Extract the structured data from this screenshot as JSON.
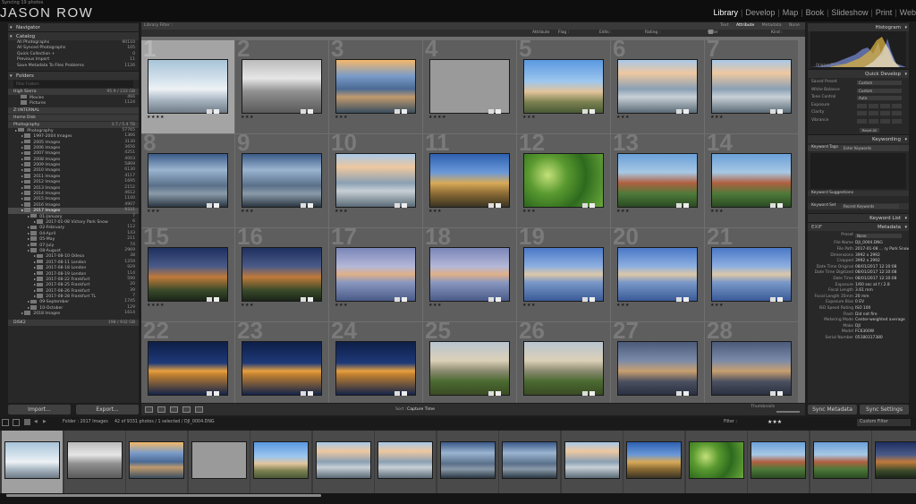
{
  "topbar": {
    "catalog_name": "Syncing 19 photos",
    "brand": "JASON ROW",
    "modules": [
      "Library",
      "Develop",
      "Map",
      "Book",
      "Slideshow",
      "Print",
      "Web"
    ],
    "active_module": "Library"
  },
  "navigator": {
    "title": "Navigator",
    "options": [
      "Fit",
      "Fill",
      "1:1",
      "3:1"
    ]
  },
  "catalog": {
    "title": "Catalog",
    "items": [
      {
        "label": "All Photographs",
        "count": "90110"
      },
      {
        "label": "All Synced Photographs",
        "count": "105"
      },
      {
        "label": "Quick Collection +",
        "count": "0"
      },
      {
        "label": "Previous Import",
        "count": "11"
      },
      {
        "label": "Save Metadata To Files Problems",
        "count": "1126"
      }
    ]
  },
  "folders": {
    "title": "Folders",
    "filter_placeholder": "Filter Folders",
    "volumes": [
      {
        "name": "High Sierra",
        "count": "95.9 / 233 GB"
      },
      {
        "name": "Z:\\INTERNAL",
        "count": ""
      },
      {
        "name": "Home Disk",
        "count": ""
      },
      {
        "name": "Photography",
        "count": "3.7 / 5.4 TB"
      }
    ],
    "high_sierra_items": [
      {
        "label": "Movies",
        "count": "466"
      },
      {
        "label": "Pictures",
        "count": "1124"
      }
    ],
    "photo_items": [
      {
        "label": "Photography",
        "count": "57765",
        "depth": 0
      },
      {
        "label": "1997-2004 Images",
        "count": "1366",
        "depth": 1
      },
      {
        "label": "2005 Images",
        "count": "3130",
        "depth": 1
      },
      {
        "label": "2006 Images",
        "count": "3656",
        "depth": 1
      },
      {
        "label": "2007 Images",
        "count": "4251",
        "depth": 1
      },
      {
        "label": "2008 Images",
        "count": "4003",
        "depth": 1
      },
      {
        "label": "2009 Images",
        "count": "5869",
        "depth": 1
      },
      {
        "label": "2010 Images",
        "count": "6130",
        "depth": 1
      },
      {
        "label": "2011 Images",
        "count": "4117",
        "depth": 1
      },
      {
        "label": "2012 Images",
        "count": "1695",
        "depth": 1
      },
      {
        "label": "2013 Images",
        "count": "2152",
        "depth": 1
      },
      {
        "label": "2014 Images",
        "count": "4612",
        "depth": 1
      },
      {
        "label": "2015 Images",
        "count": "1100",
        "depth": 1
      },
      {
        "label": "2016 Images",
        "count": "4907",
        "depth": 1
      },
      {
        "label": "2017 Images",
        "count": "9331",
        "depth": 1,
        "sel": true
      },
      {
        "label": "01-January",
        "count": "7",
        "depth": 2
      },
      {
        "label": "2017-01-08 Victory Park Snow",
        "count": "6",
        "depth": 3
      },
      {
        "label": "02-February",
        "count": "112",
        "depth": 2
      },
      {
        "label": "04-April",
        "count": "143",
        "depth": 2
      },
      {
        "label": "05-May",
        "count": "211",
        "depth": 2
      },
      {
        "label": "07-July",
        "count": "74",
        "depth": 2
      },
      {
        "label": "08-August",
        "count": "2969",
        "depth": 2
      },
      {
        "label": "2017-08-10 Odesa",
        "count": "38",
        "depth": 3
      },
      {
        "label": "2017-08-11 London",
        "count": "1259",
        "depth": 3
      },
      {
        "label": "2017-08-18 London",
        "count": "929",
        "depth": 3
      },
      {
        "label": "2017-08-19 London",
        "count": "114",
        "depth": 3
      },
      {
        "label": "2017-08-22 Frankfurt",
        "count": "590",
        "depth": 3
      },
      {
        "label": "2017-08-25 Frankfurt",
        "count": "20",
        "depth": 3
      },
      {
        "label": "2017-08-26 Frankfurt",
        "count": "39",
        "depth": 3
      },
      {
        "label": "2017-08-28 Frankfurt TL",
        "count": "7",
        "depth": 3
      },
      {
        "label": "09-September",
        "count": "1745",
        "depth": 2
      },
      {
        "label": "10-October",
        "count": "129",
        "depth": 2
      },
      {
        "label": "2018 Images",
        "count": "1614",
        "depth": 1
      }
    ],
    "bottom_volume": {
      "name": "DISK2",
      "count": "198 / 932 GB"
    }
  },
  "buttons": {
    "import": "Import...",
    "export": "Export...",
    "sync_metadata": "Sync Metadata",
    "sync_settings": "Sync Settings"
  },
  "library_filter": {
    "title": "Library Filter :",
    "tabs": [
      "Text",
      "Attribute",
      "Metadata",
      "None"
    ],
    "active": "Attribute",
    "attr_label": "Attribute",
    "flag_label": "Flag :",
    "edits_label": "Edits :",
    "rating_label": "Rating :",
    "color_label": "Color :",
    "kind_label": "Kind :",
    "color_swatches": [
      "#c83c3c",
      "#d8c040",
      "#50a040",
      "#4070c8",
      "#8050b0",
      "#888888"
    ]
  },
  "grid": {
    "cells": [
      {
        "n": "1",
        "cls": "t-snow",
        "stars": "★★★★",
        "sel": true
      },
      {
        "n": "2",
        "cls": "t-bw",
        "stars": "★★★"
      },
      {
        "n": "3",
        "cls": "t-opera",
        "stars": "★★★"
      },
      {
        "n": "4",
        "cls": "t-gray",
        "stars": "★★★★"
      },
      {
        "n": "5",
        "cls": "t-opera2",
        "stars": "★★★"
      },
      {
        "n": "6",
        "cls": "t-city",
        "stars": "★★★"
      },
      {
        "n": "7",
        "cls": "t-city",
        "stars": "★★★"
      },
      {
        "n": "8",
        "cls": "t-cityd",
        "stars": "★★★"
      },
      {
        "n": "9",
        "cls": "t-cityd",
        "stars": "★★★"
      },
      {
        "n": "10",
        "cls": "t-city",
        "stars": "★★★"
      },
      {
        "n": "11",
        "cls": "t-square",
        "stars": "★★★"
      },
      {
        "n": "12",
        "cls": "t-leaves",
        "stars": "★★★"
      },
      {
        "n": "13",
        "cls": "t-red",
        "stars": "★★★"
      },
      {
        "n": "14",
        "cls": "t-red",
        "stars": "★★★"
      },
      {
        "n": "15",
        "cls": "t-dusk",
        "stars": "★★★★"
      },
      {
        "n": "16",
        "cls": "t-dusk",
        "stars": "★★★"
      },
      {
        "n": "17",
        "cls": "t-parl",
        "stars": "★★★"
      },
      {
        "n": "18",
        "cls": "t-parl",
        "stars": "★★★"
      },
      {
        "n": "19",
        "cls": "t-parlb",
        "stars": "★★★"
      },
      {
        "n": "20",
        "cls": "t-parlb",
        "stars": "★★★"
      },
      {
        "n": "21",
        "cls": "t-parlb",
        "stars": "★★★"
      },
      {
        "n": "22",
        "cls": "t-night",
        "stars": ""
      },
      {
        "n": "23",
        "cls": "t-night",
        "stars": ""
      },
      {
        "n": "24",
        "cls": "t-night",
        "stars": ""
      },
      {
        "n": "25",
        "cls": "t-panos",
        "stars": ""
      },
      {
        "n": "26",
        "cls": "t-panos",
        "stars": ""
      },
      {
        "n": "27",
        "cls": "t-bridge",
        "stars": ""
      },
      {
        "n": "28",
        "cls": "t-bridge",
        "stars": ""
      }
    ]
  },
  "toolbar": {
    "sort_label": "Sort :",
    "sort_value": "Capture Time",
    "thumbnails_label": "Thumbnails"
  },
  "histogram": {
    "title": "Histogram",
    "original_photo": "Original Photo"
  },
  "quick_develop": {
    "title": "Quick Develop",
    "rows": [
      {
        "k": "Saved Preset",
        "v": "Custom"
      },
      {
        "k": "White Balance",
        "v": "Custom"
      },
      {
        "k": "Tone Control",
        "v": "Auto"
      },
      {
        "k": "Exposure",
        "v": ""
      },
      {
        "k": "Clarity",
        "v": ""
      },
      {
        "k": "Vibrance",
        "v": ""
      }
    ],
    "reset": "Reset All"
  },
  "keywording": {
    "title": "Keywording",
    "tags_label": "Keyword Tags",
    "tags_value": "Enter Keywords",
    "suggestions": "Keyword Suggestions",
    "set_label": "Keyword Set",
    "set_value": "Recent Keywords"
  },
  "keyword_list": {
    "title": "Keyword List"
  },
  "metadata": {
    "title": "Metadata",
    "preset_label": "EXIF",
    "preset_row": {
      "k": "Preset",
      "v": "None"
    },
    "rows": [
      {
        "k": "File Name",
        "v": "DJI_0004.DNG"
      },
      {
        "k": "File Path",
        "v": "2017-01-08 ... ry Park Snow"
      },
      {
        "k": "Dimensions",
        "v": "3992 x 2992"
      },
      {
        "k": "Cropped",
        "v": "3992 x 2992"
      },
      {
        "k": "Date Time Original",
        "v": "08/01/2017 12:10:08"
      },
      {
        "k": "Date Time Digitized",
        "v": "08/01/2017 12:10:08"
      },
      {
        "k": "Date Time",
        "v": "08/01/2017 12:10:08"
      },
      {
        "k": "Exposure",
        "v": "1/60 sec at f / 2.8"
      },
      {
        "k": "Focal Length",
        "v": "3.61 mm"
      },
      {
        "k": "Focal Length 35mm",
        "v": "20 mm"
      },
      {
        "k": "Exposure Bias",
        "v": "0 EV"
      },
      {
        "k": "ISO Speed Rating",
        "v": "ISO 100"
      },
      {
        "k": "Flash",
        "v": "Did not fire"
      },
      {
        "k": "Metering Mode",
        "v": "Center-weighted average"
      },
      {
        "k": "Make",
        "v": "DJI"
      },
      {
        "k": "Model",
        "v": "FC6300W"
      },
      {
        "k": "Serial Number",
        "v": "05180317380"
      }
    ]
  },
  "filmbar": {
    "path": "Folder : 2017 Images",
    "status": "42 of 9331 photos / 1 selected / DJI_0004.DNG",
    "filter_label": "Filter :",
    "filter_value": "Custom Filter",
    "stars": "★★★"
  },
  "filmstrip": [
    "t-snow",
    "t-bw",
    "t-opera",
    "t-gray",
    "t-opera2",
    "t-city",
    "t-city",
    "t-cityd",
    "t-cityd",
    "t-city",
    "t-square",
    "t-leaves",
    "t-red",
    "t-red",
    "t-dusk"
  ]
}
